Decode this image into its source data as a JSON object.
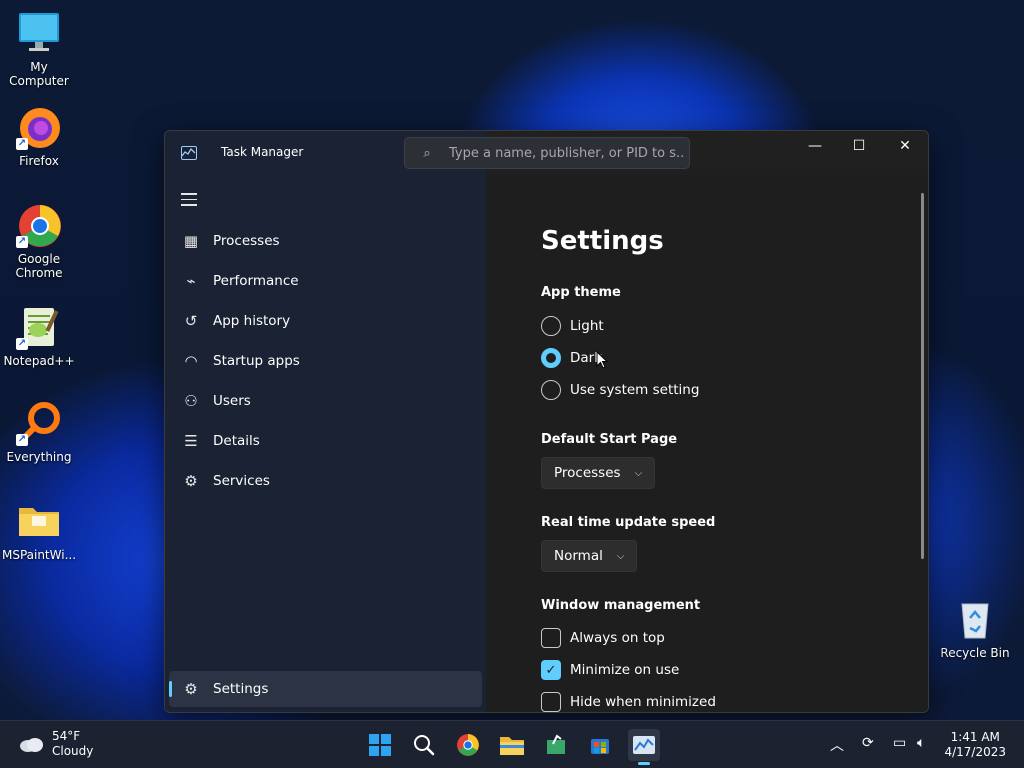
{
  "desktop": {
    "icons": [
      {
        "label": "My Computer",
        "icon": "monitor-icon"
      },
      {
        "label": "Firefox",
        "icon": "firefox-icon"
      },
      {
        "label": "Google Chrome",
        "icon": "chrome-icon"
      },
      {
        "label": "Notepad++",
        "icon": "notepadpp-icon"
      },
      {
        "label": "Everything",
        "icon": "everything-search-icon"
      },
      {
        "label": "MSPaintWi...",
        "icon": "folder-icon"
      },
      {
        "label": "Recycle Bin",
        "icon": "recycle-bin-icon"
      }
    ]
  },
  "window": {
    "title": "Task Manager",
    "search_placeholder": "Type a name, publisher, or PID to s...",
    "controls": {
      "minimize": "—",
      "maximize": "☐",
      "close": "✕"
    }
  },
  "nav": {
    "items": [
      {
        "label": "Processes",
        "icon": "processes-icon"
      },
      {
        "label": "Performance",
        "icon": "performance-icon"
      },
      {
        "label": "App history",
        "icon": "history-icon"
      },
      {
        "label": "Startup apps",
        "icon": "startup-icon"
      },
      {
        "label": "Users",
        "icon": "users-icon"
      },
      {
        "label": "Details",
        "icon": "details-icon"
      },
      {
        "label": "Services",
        "icon": "services-icon"
      }
    ],
    "settings_label": "Settings"
  },
  "settings": {
    "title": "Settings",
    "app_theme": {
      "heading": "App theme",
      "options": [
        "Light",
        "Dark",
        "Use system setting"
      ],
      "selected": "Dark"
    },
    "start_page": {
      "heading": "Default Start Page",
      "value": "Processes"
    },
    "update_speed": {
      "heading": "Real time update speed",
      "value": "Normal"
    },
    "window_mgmt": {
      "heading": "Window management",
      "options": [
        {
          "label": "Always on top",
          "checked": false
        },
        {
          "label": "Minimize on use",
          "checked": true
        },
        {
          "label": "Hide when minimized",
          "checked": false
        }
      ]
    }
  },
  "taskbar": {
    "weather": {
      "temp": "54°F",
      "condition": "Cloudy"
    },
    "clock": {
      "time": "1:41 AM",
      "date": "4/17/2023"
    },
    "apps": [
      "start-icon",
      "search-icon",
      "chrome-icon",
      "file-explorer-icon",
      "app-icon",
      "store-icon",
      "task-manager-icon"
    ],
    "active_app": "task-manager-icon"
  },
  "colors": {
    "accent": "#60cdff",
    "window_bg": "#1e1e1e",
    "nav_bg": "#1b2233"
  }
}
